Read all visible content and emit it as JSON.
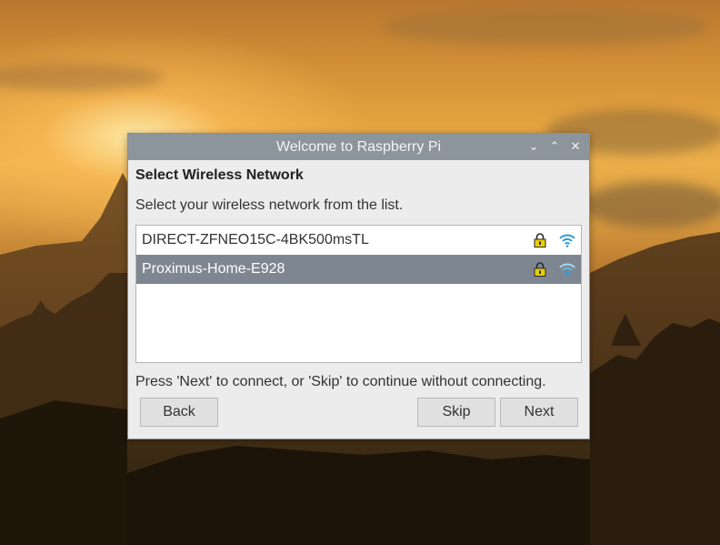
{
  "window": {
    "title": "Welcome to Raspberry Pi",
    "minimize_glyph": "⌄",
    "maximize_glyph": "⌃",
    "close_glyph": "✕"
  },
  "page": {
    "heading": "Select Wireless Network",
    "instruction": "Select your wireless network from the list.",
    "footer_hint": "Press 'Next' to connect, or 'Skip' to continue without connecting."
  },
  "networks": [
    {
      "ssid": "DIRECT-ZFNEO15C-4BK500msTL",
      "secured": true,
      "selected": false
    },
    {
      "ssid": "Proximus-Home-E928",
      "secured": true,
      "selected": true
    }
  ],
  "buttons": {
    "back": "Back",
    "skip": "Skip",
    "next": "Next"
  },
  "colors": {
    "titlebar": "#8c949c",
    "selected_row": "#7e8791",
    "lock": "#e7cf00",
    "wifi": "#2f9bd6"
  },
  "icons": {
    "lock": "lock-icon",
    "wifi": "wifi-signal-icon"
  }
}
